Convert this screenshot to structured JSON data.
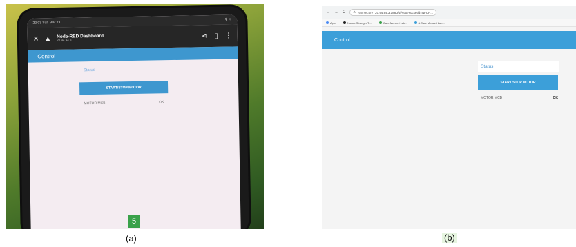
{
  "panel_a": {
    "status_bar": {
      "time": "22:03 Sat, Mar 23",
      "right": "⚲ ⌔"
    },
    "app_bar": {
      "title": "Node-RED Dashboard",
      "subtitle": "20.94.94.3"
    },
    "header": {
      "title": "Control"
    },
    "group_label": "Status",
    "button_label": "START/STOP MOTOR",
    "row": {
      "label": "MOTOR MCB",
      "value": "OK"
    },
    "badge": "5",
    "caption": "(a)"
  },
  "panel_b": {
    "url": {
      "not_secure": "Not secure",
      "address": "20.94.94.3:1880/ui/#!/0?socketid=NFUR..."
    },
    "bookmarks": [
      "Apps",
      "Nonce Stranger Tr...",
      "Care Menceli Lab...",
      "A Care Menceli Lab..."
    ],
    "header": {
      "title": "Control"
    },
    "group_label": "Status",
    "button_label": "START/STOP MOTOR",
    "row": {
      "label": "MOTOR MCB",
      "value": "OK"
    },
    "caption": "(b)"
  },
  "colors": {
    "accent": "#3c9fd9",
    "badge": "#3aa14a"
  }
}
